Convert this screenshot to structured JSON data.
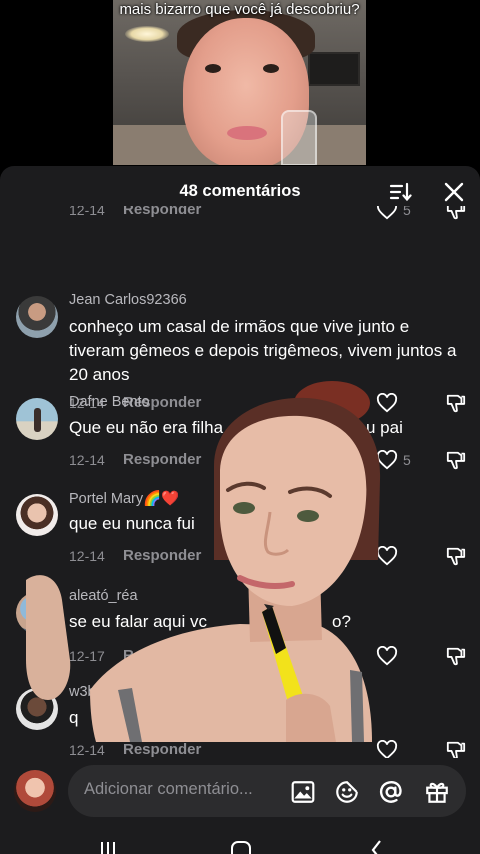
{
  "video": {
    "caption": "mais bizarro que você já descobriu?"
  },
  "sheet": {
    "title": "48 comentários"
  },
  "partial_row": {
    "date": "12-14",
    "reply": "Responder",
    "likes": "5"
  },
  "comments": [
    {
      "user": "Jean Carlos92366",
      "text": "conheço um casal de irmãos que vive junto e tiveram gêmeos e depois trigêmeos, vivem juntos a 20 anos",
      "date": "12-14",
      "reply": "Responder",
      "likes": ""
    },
    {
      "user": "Dafne Bento",
      "text": "Que eu não era filha",
      "text_tail": "u pai",
      "date": "12-14",
      "reply": "Responder",
      "likes": "5"
    },
    {
      "user": "Portel Mary🌈❤️",
      "text": "que eu nunca fui",
      "date": "12-14",
      "reply": "Responder",
      "likes": ""
    },
    {
      "user": "aleató_réa",
      "text": "se eu falar aqui vc",
      "text_tail": "o?",
      "date": "12-17",
      "reply": "Responder",
      "likes": ""
    },
    {
      "user": "w3b_b",
      "text": "q",
      "date": "12-14",
      "reply": "Responder",
      "likes": ""
    }
  ],
  "input": {
    "placeholder": "Adicionar comentário..."
  },
  "icons": {
    "sort": "sort-icon",
    "close": "close-icon",
    "like": "heart-icon",
    "dislike": "thumbs-down-icon",
    "image": "image-icon",
    "emoji": "emoji-icon",
    "mention": "at-icon",
    "gift": "gift-icon"
  },
  "colors": {
    "sheet_bg": "#1c1c1e",
    "input_bg": "#2c2c2e",
    "muted_text": "#8e8e93",
    "username": "#b8b8bd"
  }
}
